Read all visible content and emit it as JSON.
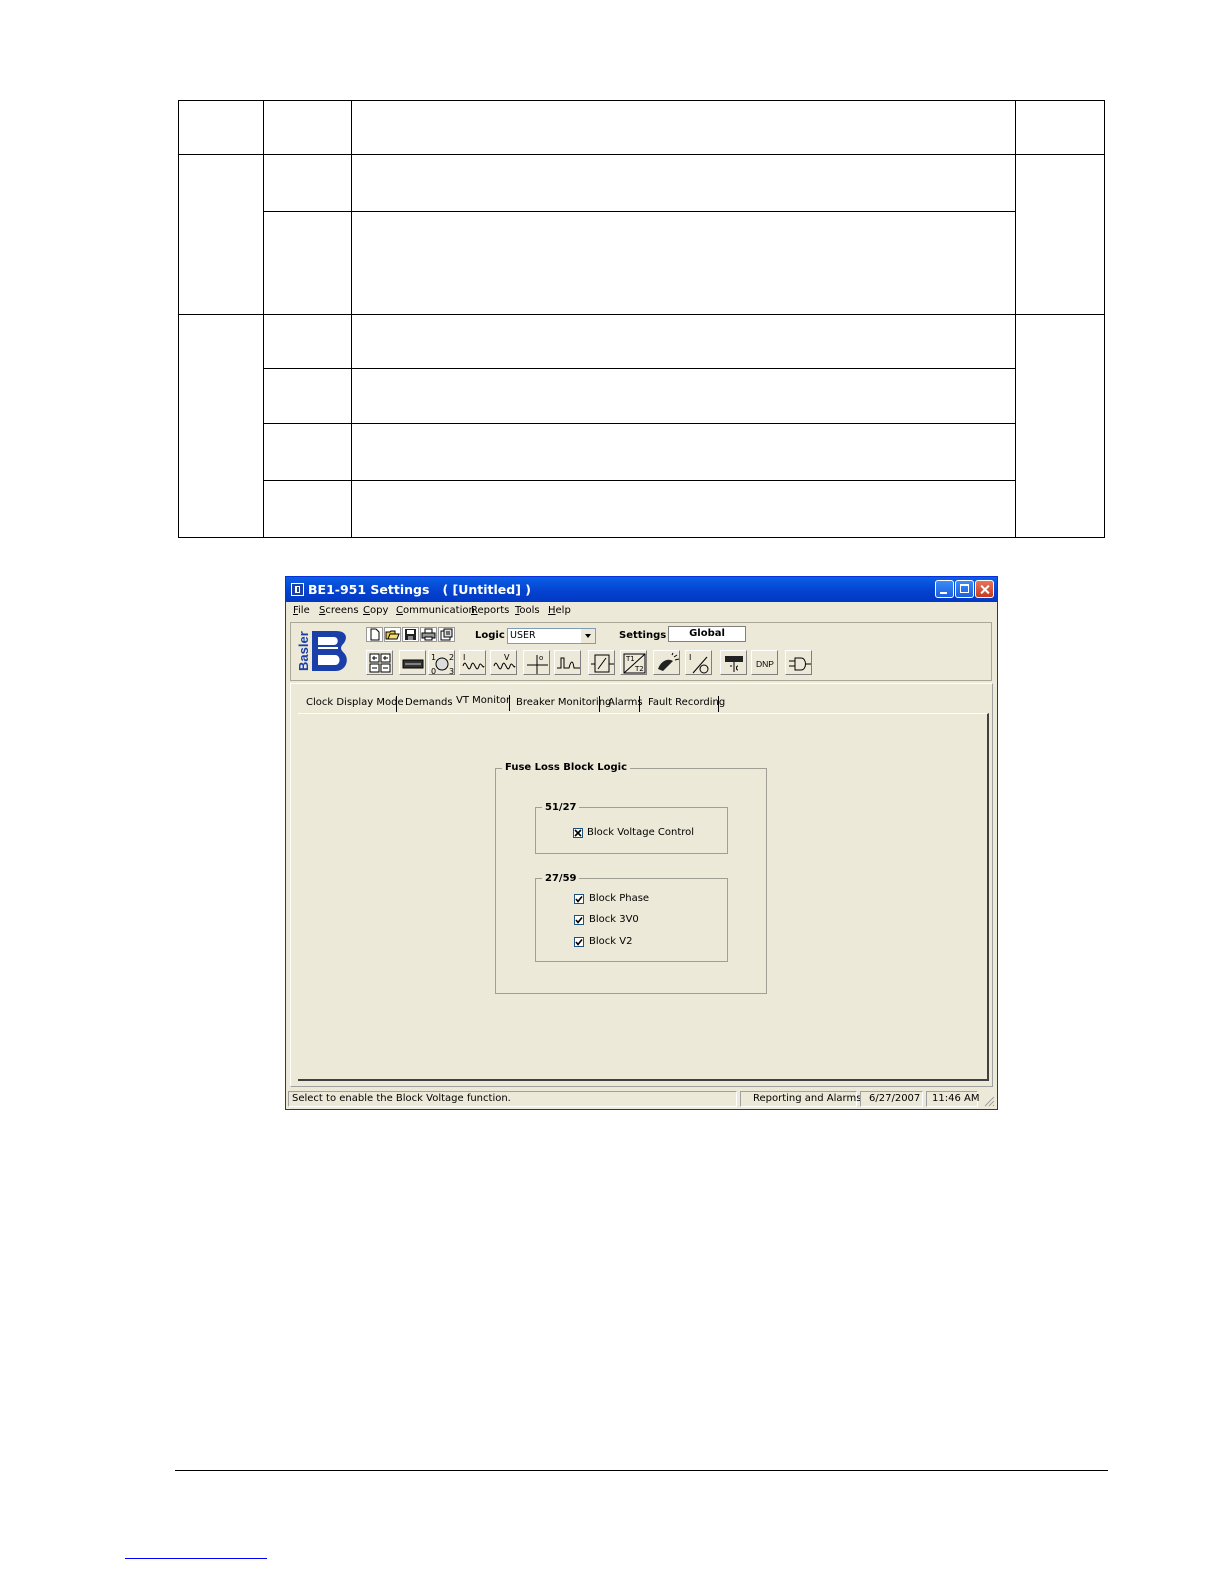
{
  "window": {
    "title": "BE1-951 Settings   ( [Untitled] )",
    "menu": [
      "File",
      "Screens",
      "Copy",
      "Communication",
      "Reports",
      "Tools",
      "Help"
    ],
    "logo_text": "Basler",
    "toolbar": {
      "logic_label": "Logic",
      "logic_value": "USER",
      "settings_label": "Settings",
      "settings_value": "Global",
      "dnp_label": "DNP"
    },
    "tabs": [
      "Clock Display Mode",
      "Demands",
      "VT Monitor",
      "Breaker Monitoring",
      "Alarms",
      "Fault Recording"
    ],
    "active_tab": "VT Monitor",
    "fuse_loss": {
      "title": "Fuse Loss Block Logic",
      "group_51_27": {
        "title": "51/27",
        "items": [
          {
            "label": "Block Voltage Control",
            "checked": true
          }
        ]
      },
      "group_27_59": {
        "title": "27/59",
        "items": [
          {
            "label": "Block Phase",
            "checked": true
          },
          {
            "label": "Block 3V0",
            "checked": true
          },
          {
            "label": "Block V2",
            "checked": true
          }
        ]
      }
    },
    "status": {
      "message": "Select to enable the Block Voltage function.",
      "section": "Reporting and Alarms",
      "date": "6/27/2007",
      "time": "11:46 AM"
    }
  }
}
